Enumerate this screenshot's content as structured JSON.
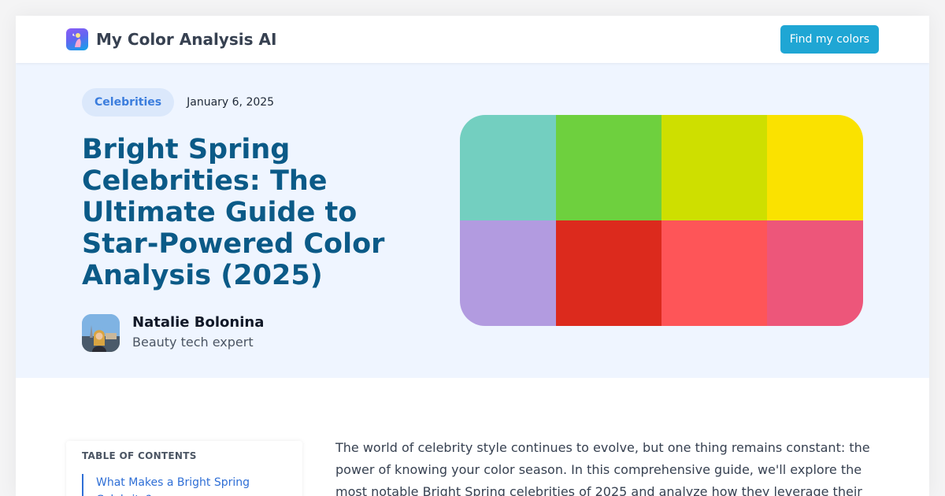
{
  "header": {
    "brand_name": "My Color Analysis AI",
    "cta_label": "Find my colors"
  },
  "article": {
    "category": "Celebrities",
    "date": "January 6, 2025",
    "title": "Bright Spring Celebrities: The Ultimate Guide to Star-Powered Color Analysis (2025)",
    "author": {
      "name": "Natalie Bolonina",
      "role": "Beauty tech expert"
    }
  },
  "palette": {
    "colors": [
      "#73cfc0",
      "#6ed03e",
      "#cedf00",
      "#fae200",
      "#b29be0",
      "#dc2a1d",
      "#fe5558",
      "#ed567a"
    ]
  },
  "toc": {
    "heading": "TABLE OF CONTENTS",
    "items": [
      {
        "label": "What Makes a Bright Spring Celebrity?"
      }
    ]
  },
  "content": {
    "intro": "The world of celebrity style continues to evolve, but one thing remains constant: the power of knowing your color season. In this comprehensive guide, we'll explore the most notable Bright Spring celebrities of 2025 and analyze how they leverage their"
  },
  "colors": {
    "accent": "#1fa6d4",
    "title": "#0b5a87",
    "hero_bg": "#eff5ff",
    "link": "#2f6fd6"
  }
}
